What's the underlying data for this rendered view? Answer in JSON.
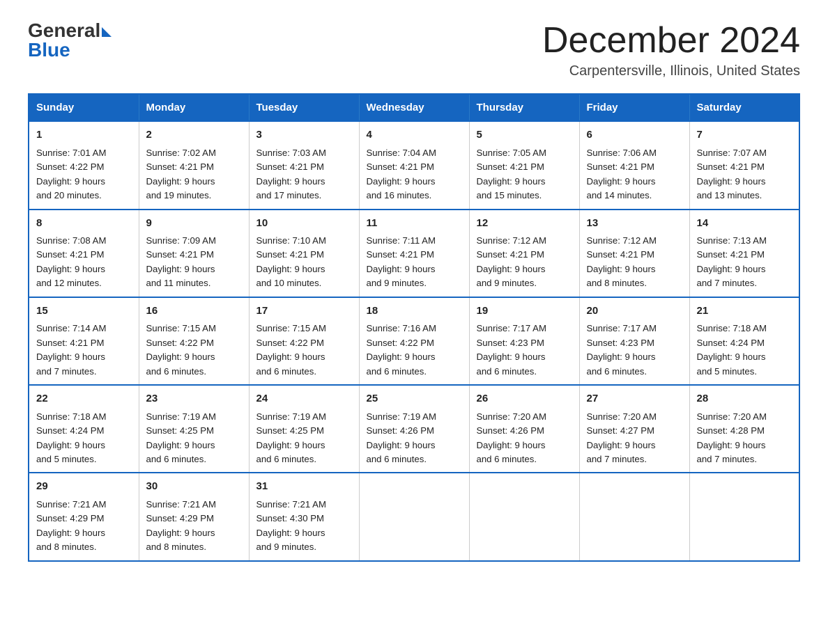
{
  "header": {
    "logo_general": "General",
    "logo_blue": "Blue",
    "month_title": "December 2024",
    "subtitle": "Carpentersville, Illinois, United States"
  },
  "weekdays": [
    "Sunday",
    "Monday",
    "Tuesday",
    "Wednesday",
    "Thursday",
    "Friday",
    "Saturday"
  ],
  "weeks": [
    [
      {
        "day": "1",
        "sunrise": "7:01 AM",
        "sunset": "4:22 PM",
        "daylight": "9 hours and 20 minutes."
      },
      {
        "day": "2",
        "sunrise": "7:02 AM",
        "sunset": "4:21 PM",
        "daylight": "9 hours and 19 minutes."
      },
      {
        "day": "3",
        "sunrise": "7:03 AM",
        "sunset": "4:21 PM",
        "daylight": "9 hours and 17 minutes."
      },
      {
        "day": "4",
        "sunrise": "7:04 AM",
        "sunset": "4:21 PM",
        "daylight": "9 hours and 16 minutes."
      },
      {
        "day": "5",
        "sunrise": "7:05 AM",
        "sunset": "4:21 PM",
        "daylight": "9 hours and 15 minutes."
      },
      {
        "day": "6",
        "sunrise": "7:06 AM",
        "sunset": "4:21 PM",
        "daylight": "9 hours and 14 minutes."
      },
      {
        "day": "7",
        "sunrise": "7:07 AM",
        "sunset": "4:21 PM",
        "daylight": "9 hours and 13 minutes."
      }
    ],
    [
      {
        "day": "8",
        "sunrise": "7:08 AM",
        "sunset": "4:21 PM",
        "daylight": "9 hours and 12 minutes."
      },
      {
        "day": "9",
        "sunrise": "7:09 AM",
        "sunset": "4:21 PM",
        "daylight": "9 hours and 11 minutes."
      },
      {
        "day": "10",
        "sunrise": "7:10 AM",
        "sunset": "4:21 PM",
        "daylight": "9 hours and 10 minutes."
      },
      {
        "day": "11",
        "sunrise": "7:11 AM",
        "sunset": "4:21 PM",
        "daylight": "9 hours and 9 minutes."
      },
      {
        "day": "12",
        "sunrise": "7:12 AM",
        "sunset": "4:21 PM",
        "daylight": "9 hours and 9 minutes."
      },
      {
        "day": "13",
        "sunrise": "7:12 AM",
        "sunset": "4:21 PM",
        "daylight": "9 hours and 8 minutes."
      },
      {
        "day": "14",
        "sunrise": "7:13 AM",
        "sunset": "4:21 PM",
        "daylight": "9 hours and 7 minutes."
      }
    ],
    [
      {
        "day": "15",
        "sunrise": "7:14 AM",
        "sunset": "4:21 PM",
        "daylight": "9 hours and 7 minutes."
      },
      {
        "day": "16",
        "sunrise": "7:15 AM",
        "sunset": "4:22 PM",
        "daylight": "9 hours and 6 minutes."
      },
      {
        "day": "17",
        "sunrise": "7:15 AM",
        "sunset": "4:22 PM",
        "daylight": "9 hours and 6 minutes."
      },
      {
        "day": "18",
        "sunrise": "7:16 AM",
        "sunset": "4:22 PM",
        "daylight": "9 hours and 6 minutes."
      },
      {
        "day": "19",
        "sunrise": "7:17 AM",
        "sunset": "4:23 PM",
        "daylight": "9 hours and 6 minutes."
      },
      {
        "day": "20",
        "sunrise": "7:17 AM",
        "sunset": "4:23 PM",
        "daylight": "9 hours and 6 minutes."
      },
      {
        "day": "21",
        "sunrise": "7:18 AM",
        "sunset": "4:24 PM",
        "daylight": "9 hours and 5 minutes."
      }
    ],
    [
      {
        "day": "22",
        "sunrise": "7:18 AM",
        "sunset": "4:24 PM",
        "daylight": "9 hours and 5 minutes."
      },
      {
        "day": "23",
        "sunrise": "7:19 AM",
        "sunset": "4:25 PM",
        "daylight": "9 hours and 6 minutes."
      },
      {
        "day": "24",
        "sunrise": "7:19 AM",
        "sunset": "4:25 PM",
        "daylight": "9 hours and 6 minutes."
      },
      {
        "day": "25",
        "sunrise": "7:19 AM",
        "sunset": "4:26 PM",
        "daylight": "9 hours and 6 minutes."
      },
      {
        "day": "26",
        "sunrise": "7:20 AM",
        "sunset": "4:26 PM",
        "daylight": "9 hours and 6 minutes."
      },
      {
        "day": "27",
        "sunrise": "7:20 AM",
        "sunset": "4:27 PM",
        "daylight": "9 hours and 7 minutes."
      },
      {
        "day": "28",
        "sunrise": "7:20 AM",
        "sunset": "4:28 PM",
        "daylight": "9 hours and 7 minutes."
      }
    ],
    [
      {
        "day": "29",
        "sunrise": "7:21 AM",
        "sunset": "4:29 PM",
        "daylight": "9 hours and 8 minutes."
      },
      {
        "day": "30",
        "sunrise": "7:21 AM",
        "sunset": "4:29 PM",
        "daylight": "9 hours and 8 minutes."
      },
      {
        "day": "31",
        "sunrise": "7:21 AM",
        "sunset": "4:30 PM",
        "daylight": "9 hours and 9 minutes."
      },
      null,
      null,
      null,
      null
    ]
  ],
  "labels": {
    "sunrise": "Sunrise:",
    "sunset": "Sunset:",
    "daylight": "Daylight:"
  }
}
